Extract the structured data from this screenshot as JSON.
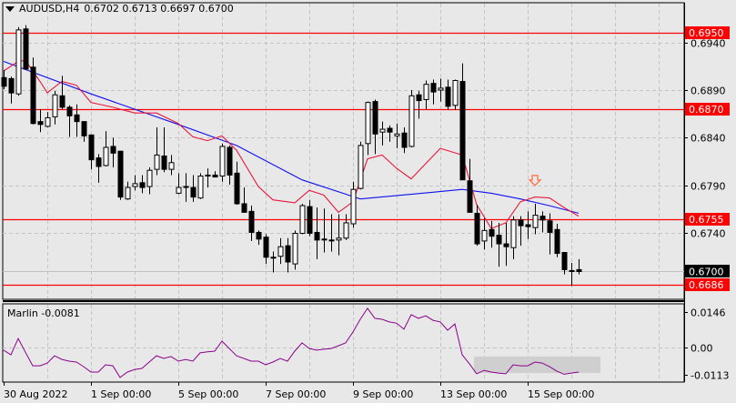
{
  "header": {
    "symbol": "AUDUSD,H4",
    "ohlc": "0.6702 0.6713 0.6697 0.6700"
  },
  "indicator": {
    "label": "Marlin -0.0081"
  },
  "colors": {
    "background": "#e8e8e8",
    "level_line": "#ff0000",
    "fast_ma": "#e8173a",
    "slow_ma": "#1010ee",
    "oscillator": "#8b008b",
    "arrow": "#ff6a3d",
    "highlight": "#cfcfcf"
  },
  "chart_data": [
    {
      "type": "candlestick",
      "title": "AUDUSD,H4",
      "ylim": [
        0.668,
        0.6982
      ],
      "y_ticks": [
        "0.6940",
        "0.6890",
        "0.6840",
        "0.6790",
        "0.6740"
      ],
      "x_tick_labels": [
        {
          "index": 0,
          "label": "30 Aug 2022"
        },
        {
          "index": 12,
          "label": "1 Sep 00:00"
        },
        {
          "index": 24,
          "label": "5 Sep 00:00"
        },
        {
          "index": 36,
          "label": "7 Sep 00:00"
        },
        {
          "index": 48,
          "label": "9 Sep 00:00"
        },
        {
          "index": 60,
          "label": "13 Sep 00:00"
        },
        {
          "index": 72,
          "label": "15 Sep 00:00"
        }
      ],
      "levels": [
        "0.6950",
        "0.6870",
        "0.6755",
        "0.6686"
      ],
      "current_price": "0.6700",
      "candles_ohlc": [
        [
          0.6903,
          0.6911,
          0.6891,
          0.6894
        ],
        [
          0.6902,
          0.6904,
          0.6876,
          0.6887
        ],
        [
          0.6886,
          0.6956,
          0.6884,
          0.6953
        ],
        [
          0.6954,
          0.6958,
          0.6911,
          0.6912
        ],
        [
          0.6914,
          0.6924,
          0.6854,
          0.6855
        ],
        [
          0.6857,
          0.687,
          0.6846,
          0.6854
        ],
        [
          0.6852,
          0.6867,
          0.6851,
          0.6861
        ],
        [
          0.6862,
          0.6889,
          0.6854,
          0.6885
        ],
        [
          0.6884,
          0.6905,
          0.687,
          0.6872
        ],
        [
          0.6872,
          0.6874,
          0.6841,
          0.6863
        ],
        [
          0.6864,
          0.6875,
          0.6841,
          0.6857
        ],
        [
          0.6857,
          0.6857,
          0.6836,
          0.6842
        ],
        [
          0.6843,
          0.6843,
          0.6807,
          0.6817
        ],
        [
          0.6819,
          0.6823,
          0.6793,
          0.681
        ],
        [
          0.6811,
          0.6847,
          0.681,
          0.683
        ],
        [
          0.6831,
          0.684,
          0.6809,
          0.6824
        ],
        [
          0.6826,
          0.6826,
          0.6775,
          0.6778
        ],
        [
          0.6776,
          0.6794,
          0.6775,
          0.6788
        ],
        [
          0.6789,
          0.6801,
          0.6785,
          0.6792
        ],
        [
          0.6793,
          0.6801,
          0.6782,
          0.6788
        ],
        [
          0.6789,
          0.6809,
          0.6781,
          0.6806
        ],
        [
          0.6807,
          0.6851,
          0.6801,
          0.6822
        ],
        [
          0.6821,
          0.6851,
          0.6804,
          0.6807
        ],
        [
          0.6807,
          0.6822,
          0.6801,
          0.6814
        ],
        [
          0.6782,
          0.6803,
          0.6781,
          0.6788
        ],
        [
          0.6789,
          0.6803,
          0.6773,
          0.6789
        ],
        [
          0.6788,
          0.6801,
          0.6773,
          0.6778
        ],
        [
          0.6777,
          0.6803,
          0.6776,
          0.68
        ],
        [
          0.68,
          0.6808,
          0.6788,
          0.6801
        ],
        [
          0.6801,
          0.6805,
          0.6799,
          0.6799
        ],
        [
          0.68,
          0.6834,
          0.6794,
          0.6831
        ],
        [
          0.683,
          0.6832,
          0.6791,
          0.6801
        ],
        [
          0.6803,
          0.6815,
          0.677,
          0.6771
        ],
        [
          0.6771,
          0.6788,
          0.6762,
          0.6762
        ],
        [
          0.6763,
          0.6769,
          0.6732,
          0.6741
        ],
        [
          0.6741,
          0.6743,
          0.6728,
          0.6734
        ],
        [
          0.6736,
          0.6739,
          0.6708,
          0.6715
        ],
        [
          0.6715,
          0.6721,
          0.6699,
          0.6715
        ],
        [
          0.6716,
          0.6735,
          0.6708,
          0.6726
        ],
        [
          0.6727,
          0.6735,
          0.6699,
          0.671
        ],
        [
          0.6708,
          0.6743,
          0.6702,
          0.674
        ],
        [
          0.674,
          0.6771,
          0.6739,
          0.6769
        ],
        [
          0.6768,
          0.6775,
          0.6737,
          0.674
        ],
        [
          0.6741,
          0.6767,
          0.6713,
          0.6733
        ],
        [
          0.6734,
          0.6766,
          0.672,
          0.6734
        ],
        [
          0.6733,
          0.676,
          0.6721,
          0.6733
        ],
        [
          0.6733,
          0.676,
          0.6717,
          0.6735
        ],
        [
          0.6735,
          0.676,
          0.6733,
          0.6751
        ],
        [
          0.675,
          0.6794,
          0.6746,
          0.6786
        ],
        [
          0.6787,
          0.6836,
          0.6786,
          0.6832
        ],
        [
          0.6834,
          0.6878,
          0.6822,
          0.6877
        ],
        [
          0.6878,
          0.688,
          0.6823,
          0.6844
        ],
        [
          0.6846,
          0.6857,
          0.6832,
          0.6849
        ],
        [
          0.685,
          0.6853,
          0.6836,
          0.6846
        ],
        [
          0.6842,
          0.6855,
          0.6829,
          0.6844
        ],
        [
          0.6845,
          0.6851,
          0.6824,
          0.683
        ],
        [
          0.6831,
          0.689,
          0.683,
          0.6884
        ],
        [
          0.6885,
          0.6889,
          0.686,
          0.6879
        ],
        [
          0.688,
          0.69,
          0.687,
          0.6896
        ],
        [
          0.6897,
          0.6901,
          0.6875,
          0.6888
        ],
        [
          0.689,
          0.6902,
          0.6878,
          0.6892
        ],
        [
          0.6893,
          0.6901,
          0.6869,
          0.6873
        ],
        [
          0.6874,
          0.6901,
          0.6869,
          0.69
        ],
        [
          0.6899,
          0.6918,
          0.6796,
          0.6796
        ],
        [
          0.6795,
          0.6818,
          0.6762,
          0.6762
        ],
        [
          0.6761,
          0.677,
          0.6727,
          0.6729
        ],
        [
          0.6732,
          0.6756,
          0.6723,
          0.6743
        ],
        [
          0.6744,
          0.6753,
          0.6725,
          0.6737
        ],
        [
          0.6738,
          0.6751,
          0.6705,
          0.6729
        ],
        [
          0.6729,
          0.6751,
          0.6706,
          0.6726
        ],
        [
          0.6725,
          0.6758,
          0.6713,
          0.6754
        ],
        [
          0.6754,
          0.6758,
          0.6727,
          0.6748
        ],
        [
          0.6749,
          0.6763,
          0.6734,
          0.6747
        ],
        [
          0.6746,
          0.6771,
          0.6739,
          0.6759
        ],
        [
          0.6758,
          0.6763,
          0.6741,
          0.6754
        ],
        [
          0.6753,
          0.6761,
          0.6718,
          0.6741
        ],
        [
          0.6744,
          0.675,
          0.6715,
          0.6719
        ],
        [
          0.672,
          0.672,
          0.6697,
          0.6702
        ],
        [
          0.6701,
          0.6709,
          0.6685,
          0.6701
        ],
        [
          0.6702,
          0.6713,
          0.6697,
          0.67
        ]
      ],
      "slow_ma": [
        [
          0,
          0.692
        ],
        [
          12,
          0.6886
        ],
        [
          24,
          0.6854
        ],
        [
          32,
          0.6832
        ],
        [
          41,
          0.6796
        ],
        [
          49,
          0.6776
        ],
        [
          59,
          0.6783
        ],
        [
          63,
          0.6786
        ],
        [
          67,
          0.6782
        ],
        [
          71,
          0.6776
        ],
        [
          75,
          0.6769
        ],
        [
          79,
          0.6761
        ]
      ],
      "fast_ma": [
        [
          0,
          0.691
        ],
        [
          2,
          0.692
        ],
        [
          3,
          0.6921
        ],
        [
          5,
          0.6899
        ],
        [
          6,
          0.6887
        ],
        [
          8,
          0.6899
        ],
        [
          10,
          0.6895
        ],
        [
          12,
          0.6877
        ],
        [
          15,
          0.6872
        ],
        [
          18,
          0.6866
        ],
        [
          21,
          0.6866
        ],
        [
          24,
          0.6855
        ],
        [
          26,
          0.6841
        ],
        [
          28,
          0.6837
        ],
        [
          30,
          0.6842
        ],
        [
          32,
          0.6827
        ],
        [
          35,
          0.6789
        ],
        [
          37,
          0.6775
        ],
        [
          40,
          0.6772
        ],
        [
          42,
          0.6785
        ],
        [
          44,
          0.678
        ],
        [
          46,
          0.6762
        ],
        [
          48,
          0.6773
        ],
        [
          50,
          0.6818
        ],
        [
          52,
          0.6822
        ],
        [
          54,
          0.6808
        ],
        [
          56,
          0.6797
        ],
        [
          58,
          0.6813
        ],
        [
          60,
          0.6829
        ],
        [
          63,
          0.6822
        ],
        [
          65,
          0.677
        ],
        [
          67,
          0.6745
        ],
        [
          69,
          0.6751
        ],
        [
          71,
          0.6773
        ],
        [
          73,
          0.6778
        ],
        [
          75,
          0.6777
        ],
        [
          77,
          0.6767
        ],
        [
          79,
          0.6758
        ]
      ],
      "arrow_marker": {
        "index": 73,
        "price": 0.6793,
        "direction": "down"
      }
    },
    {
      "type": "line",
      "title": "Marlin",
      "ylim": [
        -0.0146,
        0.0196
      ],
      "y_ticks": [
        "0.0146",
        "0.00",
        "-0.0113"
      ],
      "values": [
        -0.0011,
        -0.003,
        0.0037,
        -0.002,
        -0.0075,
        -0.0075,
        -0.0064,
        -0.0034,
        -0.0049,
        -0.0056,
        -0.006,
        -0.0079,
        -0.0101,
        -0.0101,
        -0.0071,
        -0.0075,
        -0.0123,
        -0.0101,
        -0.009,
        -0.0086,
        -0.006,
        -0.0034,
        -0.0045,
        -0.0037,
        -0.0056,
        -0.0049,
        -0.0056,
        -0.0022,
        -0.0018,
        -0.0015,
        0.0026,
        -0.0004,
        -0.0034,
        -0.0045,
        -0.0056,
        -0.0056,
        -0.0071,
        -0.006,
        -0.0045,
        -0.0056,
        -0.0015,
        0.0019,
        -0.0004,
        -0.0011,
        -0.0007,
        -0.0004,
        0.0007,
        0.0019,
        0.0064,
        0.0116,
        0.0161,
        0.012,
        0.0116,
        0.0105,
        0.01,
        0.0075,
        0.0135,
        0.012,
        0.013,
        0.0112,
        0.0105,
        0.0071,
        0.0097,
        -0.003,
        -0.0067,
        -0.0108,
        -0.0094,
        -0.0101,
        -0.0105,
        -0.0108,
        -0.0071,
        -0.0075,
        -0.0075,
        -0.006,
        -0.0064,
        -0.0079,
        -0.0097,
        -0.011,
        -0.0105,
        -0.0101
      ],
      "highlight": {
        "from_index": 65,
        "to_index": 82,
        "from": -0.0105,
        "to": -0.0037
      }
    }
  ]
}
